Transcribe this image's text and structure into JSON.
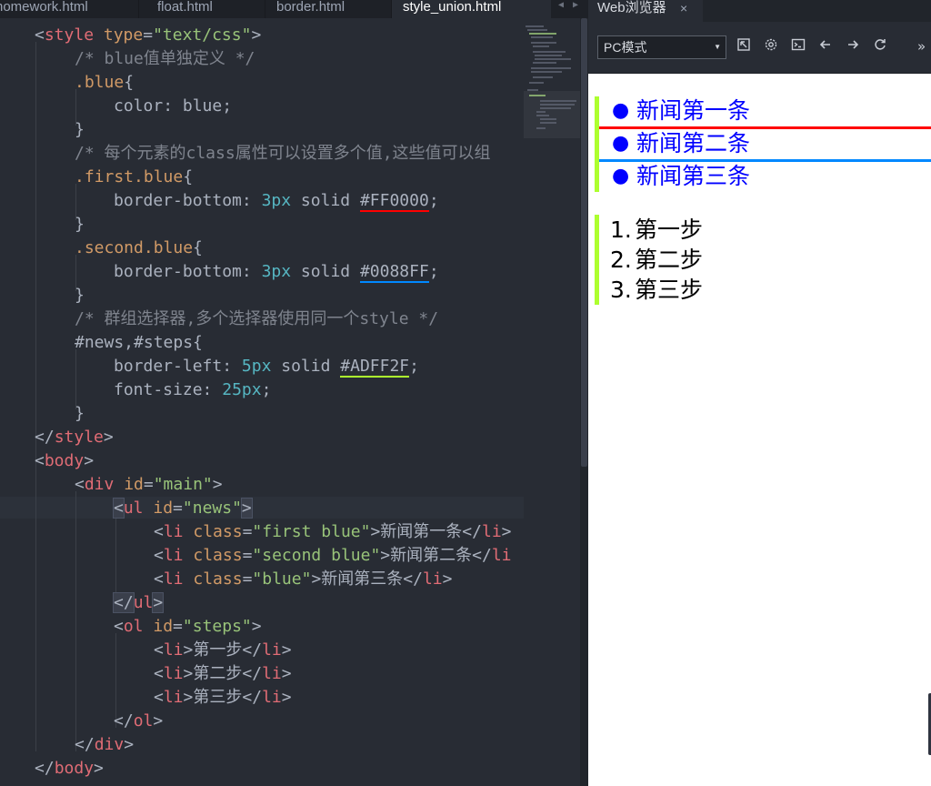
{
  "editor": {
    "tabs": [
      {
        "label": "homework.html",
        "active": false
      },
      {
        "label": "float.html",
        "active": false
      },
      {
        "label": "border.html",
        "active": false
      },
      {
        "label": "style_union.html",
        "active": true
      }
    ]
  },
  "code": {
    "l1": {
      "a": "<",
      "b": "style",
      "c": " type",
      "d": "=",
      "e": "\"text/css\"",
      "f": ">"
    },
    "l2": {
      "a": "/* blue值单独定义 */"
    },
    "l3": {
      "a": ".blue",
      "b": "{"
    },
    "l4": {
      "a": "color",
      "b": ": ",
      "c": "blue",
      "d": ";"
    },
    "l5": {
      "a": "}"
    },
    "l6": {
      "a": "/* 每个元素的class属性可以设置多个值,这些值可以组"
    },
    "l7": {
      "a": ".first.blue",
      "b": "{"
    },
    "l8": {
      "a": "border-bottom",
      "b": ": ",
      "c": "3px",
      "d": " solid ",
      "e": "#FF0000",
      "f": ";"
    },
    "l9": {
      "a": "}"
    },
    "l10": {
      "a": ".second.blue",
      "b": "{"
    },
    "l11": {
      "a": "border-bottom",
      "b": ": ",
      "c": "3px",
      "d": " solid ",
      "e": "#0088FF",
      "f": ";"
    },
    "l12": {
      "a": "}"
    },
    "l13": {
      "a": "/* 群组选择器,多个选择器使用同一个style */"
    },
    "l14": {
      "a": "#news,#steps",
      "b": "{"
    },
    "l15": {
      "a": "border-left",
      "b": ": ",
      "c": "5px",
      "d": " solid ",
      "e": "#ADFF2F",
      "f": ";"
    },
    "l16": {
      "a": "font-size",
      "b": ": ",
      "c": "25px",
      "d": ";"
    },
    "l17": {
      "a": "}"
    },
    "l18": {
      "a": "</",
      "b": "style",
      "c": ">"
    },
    "l19": {
      "a": "<",
      "b": "body",
      "c": ">"
    },
    "l20": {
      "a": "<",
      "b": "div",
      "c": " id",
      "d": "=",
      "e": "\"main\"",
      "f": ">"
    },
    "l21": {
      "a": "<",
      "b": "ul",
      "c": " id",
      "d": "=",
      "e": "\"news\"",
      "f": ">"
    },
    "l22": {
      "a": "<",
      "b": "li",
      "c": " class",
      "d": "=",
      "e": "\"first blue\"",
      "f": ">",
      "g": "新闻第一条",
      "h": "</",
      "i": "li",
      "j": ">"
    },
    "l23": {
      "a": "<",
      "b": "li",
      "c": " class",
      "d": "=",
      "e": "\"second blue\"",
      "f": ">",
      "g": "新闻第二条",
      "h": "</",
      "i": "li"
    },
    "l24": {
      "a": "<",
      "b": "li",
      "c": " class",
      "d": "=",
      "e": "\"blue\"",
      "f": ">",
      "g": "新闻第三条",
      "h": "</",
      "i": "li",
      "j": ">"
    },
    "l25": {
      "a": "</",
      "b": "ul",
      "c": ">"
    },
    "l26": {
      "a": "<",
      "b": "ol",
      "c": " id",
      "d": "=",
      "e": "\"steps\"",
      "f": ">"
    },
    "l27": {
      "a": "<",
      "b": "li",
      "c": ">",
      "d": "第一步",
      "e": "</",
      "f": "li",
      "g": ">"
    },
    "l28": {
      "a": "<",
      "b": "li",
      "c": ">",
      "d": "第二步",
      "e": "</",
      "f": "li",
      "g": ">"
    },
    "l29": {
      "a": "<",
      "b": "li",
      "c": ">",
      "d": "第三步",
      "e": "</",
      "f": "li",
      "g": ">"
    },
    "l30": {
      "a": "</",
      "b": "ol",
      "c": ">"
    },
    "l31": {
      "a": "</",
      "b": "div",
      "c": ">"
    },
    "l32": {
      "a": "</",
      "b": "body",
      "c": ">"
    }
  },
  "browser": {
    "tab_label": "Web浏览器",
    "tab_close": "×",
    "mode_value": "PC模式",
    "icons": [
      "open-external-icon",
      "settings-icon",
      "console-icon",
      "back-icon",
      "forward-icon",
      "refresh-icon",
      "more-icon"
    ],
    "news": [
      "新闻第一条",
      "新闻第二条",
      "新闻第三条"
    ],
    "steps": [
      {
        "num": "1.",
        "label": "第一步"
      },
      {
        "num": "2.",
        "label": "第二步"
      },
      {
        "num": "3.",
        "label": "第三步"
      }
    ]
  },
  "colors": {
    "editor_bg": "#282c34",
    "tag": "#e06c75",
    "attr": "#d19a66",
    "string": "#98c379",
    "comment": "#7f848e",
    "number": "#56b6c2",
    "red": "#FF0000",
    "blue": "#0088FF",
    "green": "#ADFF2F",
    "link_blue": "#0000FF"
  }
}
